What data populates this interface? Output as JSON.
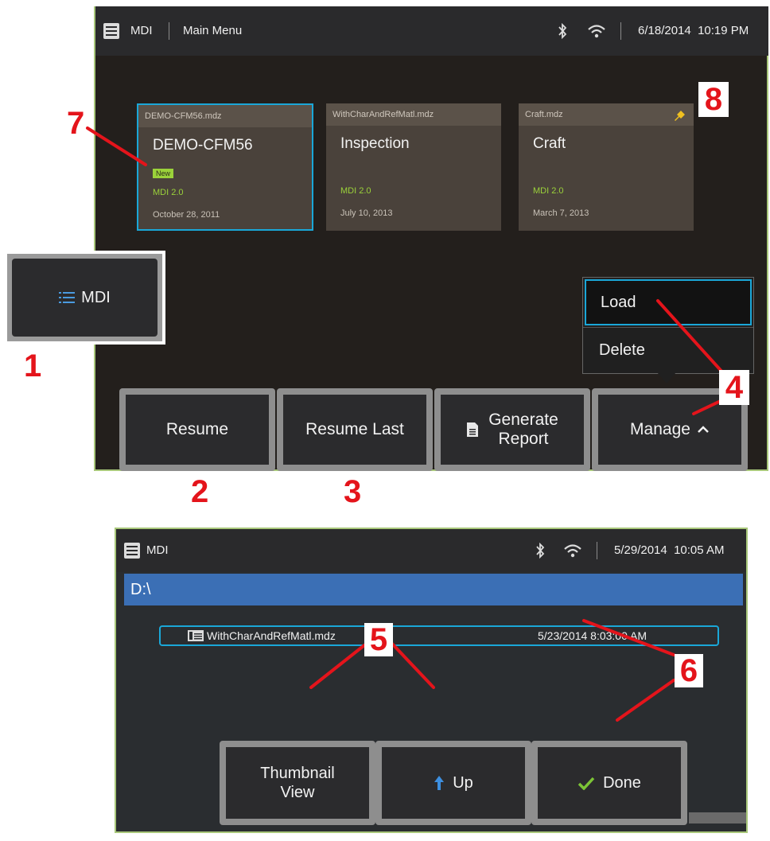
{
  "screen1": {
    "status": {
      "app": "MDI",
      "menu": "Main Menu",
      "datetime": "6/18/2014  10:19 PM"
    },
    "cards": [
      {
        "file": "DEMO-CFM56.mdz",
        "title": "DEMO-CFM56",
        "badge": "New",
        "version": "MDI 2.0",
        "date": "October 28, 2011"
      },
      {
        "file": "WithCharAndRefMatl.mdz",
        "title": "Inspection",
        "version": "MDI 2.0",
        "date": "July 10, 2013"
      },
      {
        "file": "Craft.mdz",
        "title": "Craft",
        "version": "MDI 2.0",
        "date": "March 7, 2013"
      }
    ],
    "popup": {
      "load": "Load",
      "delete": "Delete"
    },
    "buttons": {
      "resume": "Resume",
      "resume_last": "Resume Last",
      "generate_1": "Generate",
      "generate_2": "Report",
      "manage": "Manage"
    }
  },
  "mdi_button": {
    "label": "MDI"
  },
  "screen2": {
    "status": {
      "app": "MDI",
      "datetime": "5/29/2014  10:05 AM"
    },
    "path": "D:\\",
    "file": {
      "name": "WithCharAndRefMatl.mdz",
      "date": "5/23/2014 8:03:00 AM"
    },
    "buttons": {
      "thumb_1": "Thumbnail",
      "thumb_2": "View",
      "up": "Up",
      "done": "Done"
    }
  },
  "callouts": {
    "c1": "1",
    "c2": "2",
    "c3": "3",
    "c4": "4",
    "c5": "5",
    "c6": "6",
    "c7": "7",
    "c8": "8"
  },
  "colors": {
    "highlight": "#1aa7d8",
    "accent_green": "#9bd23a",
    "path_bar": "#3b6fb5",
    "callout_red": "#e4141b"
  }
}
